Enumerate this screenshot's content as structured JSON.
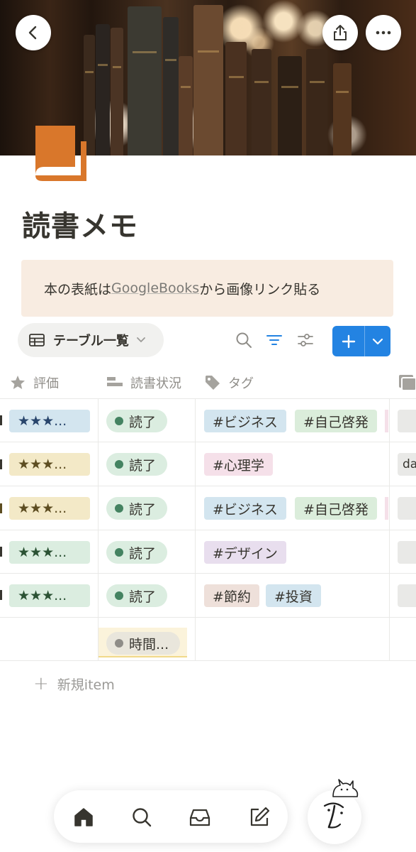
{
  "cover": {
    "description_icons": [
      "back-icon",
      "share-icon",
      "more-icon"
    ]
  },
  "page": {
    "title": "読書メモ",
    "icon": "book-icon"
  },
  "callout": {
    "text_before": "本の表紙は",
    "link_text": "GoogleBooks",
    "text_after": "から画像リンク貼る"
  },
  "view": {
    "label": "テーブル一覧",
    "icon": "table-icon"
  },
  "toolbar": {
    "icons": [
      "search-icon",
      "filter-icon",
      "sort-icon"
    ],
    "new_button": "plus-icon"
  },
  "table": {
    "columns": [
      {
        "label": "評価",
        "icon": "star-icon"
      },
      {
        "label": "読書状況",
        "icon": "status-icon"
      },
      {
        "label": "タグ",
        "icon": "tag-icon"
      }
    ],
    "rows": [
      {
        "rating": "★★★...",
        "rating_color": "#d3e5ef",
        "rating_text": "#28456c",
        "status": "読了",
        "tags": [
          {
            "label": "#ビジネス",
            "bg": "#d3e5ef"
          },
          {
            "label": "#自己啓発",
            "bg": "#dbeddb"
          }
        ],
        "extra": ""
      },
      {
        "rating": "★★★...",
        "rating_color": "#f3e9c7",
        "rating_text": "#5d4d21",
        "status": "読了",
        "tags": [
          {
            "label": "#心理学",
            "bg": "#f5e0e9"
          }
        ],
        "extra": "da"
      },
      {
        "rating": "★★★...",
        "rating_color": "#f3e9c7",
        "rating_text": "#5d4d21",
        "status": "読了",
        "tags": [
          {
            "label": "#ビジネス",
            "bg": "#d3e5ef"
          },
          {
            "label": "#自己啓発",
            "bg": "#dbeddb"
          }
        ],
        "extra": ""
      },
      {
        "rating": "★★★...",
        "rating_color": "#dbede0",
        "rating_text": "#2b5234",
        "status": "読了",
        "tags": [
          {
            "label": "#デザイン",
            "bg": "#e8deee"
          }
        ],
        "extra": ""
      },
      {
        "rating": "★★★...",
        "rating_color": "#dbede0",
        "rating_text": "#2b5234",
        "status": "読了",
        "tags": [
          {
            "label": "#節約",
            "bg": "#eee0da"
          },
          {
            "label": "#投資",
            "bg": "#d3e5ef"
          }
        ],
        "extra": ""
      },
      {
        "rating": "",
        "status": "時間...",
        "tags": [],
        "extra": ""
      }
    ],
    "new_item_label": "新規item"
  },
  "bottom_nav": [
    "home-icon",
    "search-icon",
    "inbox-icon",
    "edit-icon"
  ],
  "colors": {
    "accent": "#2383e2",
    "status_done": "#448361",
    "status_pending": "#fbf3db",
    "icon_orange": "#d9772b"
  }
}
